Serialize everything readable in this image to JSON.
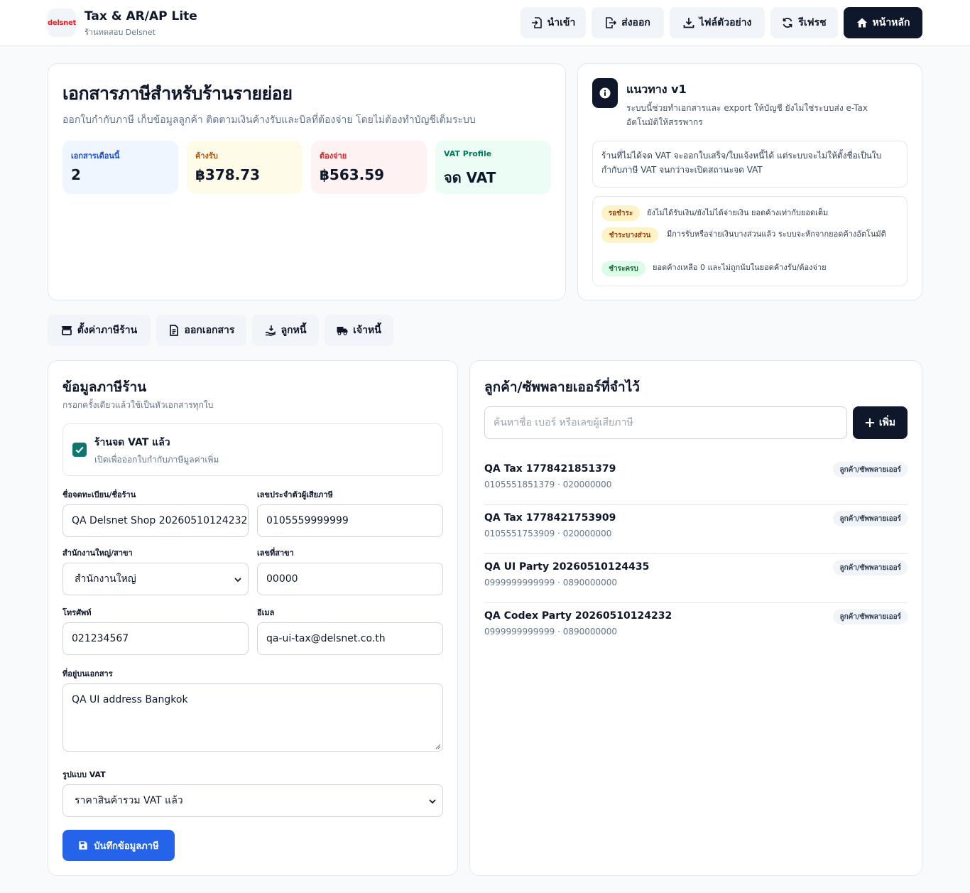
{
  "header": {
    "logo_text": "delsnet",
    "title": "Tax & AR/AP Lite",
    "subtitle": "ร้านทดสอบ Delsnet",
    "buttons": {
      "import": "นำเข้า",
      "export": "ส่งออก",
      "sample": "ไฟล์ตัวอย่าง",
      "refresh": "รีเฟรช",
      "home": "หน้าหลัก"
    }
  },
  "hero": {
    "title": "เอกสารภาษีสำหรับร้านรายย่อย",
    "subtitle": "ออกใบกำกับภาษี เก็บข้อมูลลูกค้า ติดตามเงินค้างรับและบิลที่ต้องจ่าย โดยไม่ต้องทำบัญชีเต็มระบบ",
    "stats": [
      {
        "label": "เอกสารเดือนนี้",
        "value": "2",
        "bg": "#eff6ff",
        "fg": "#1d4ed8"
      },
      {
        "label": "ค้างรับ",
        "value": "฿378.73",
        "bg": "#fefce8",
        "fg": "#b45309"
      },
      {
        "label": "ต้องจ่าย",
        "value": "฿563.59",
        "bg": "#fef2f2",
        "fg": "#dc2626"
      },
      {
        "label": "VAT Profile",
        "value": "จด VAT",
        "bg": "#ecfdf5",
        "fg": "#047857"
      }
    ]
  },
  "guide": {
    "title": "แนวทาง v1",
    "subtitle": "ระบบนี้ช่วยทำเอกสารและ export ให้บัญชี ยังไม่ใช่ระบบส่ง e-Tax อัตโนมัติให้สรรพากร",
    "note": "ร้านที่ไม่ได้จด VAT จะออกใบเสร็จ/ใบแจ้งหนี้ได้ แต่ระบบจะไม่ให้ตั้งชื่อเป็นใบกำกับภาษี VAT จนกว่าจะเปิดสถานะจด VAT",
    "statuses": [
      {
        "badge": "รอชำระ",
        "desc": "ยังไม่ได้รับเงิน/ยังไม่ได้จ่ายเงิน ยอดค้างเท่ากับยอดเต็ม",
        "bg": "#fef3c7",
        "fg": "#92400e"
      },
      {
        "badge": "ชำระบางส่วน",
        "desc": "มีการรับหรือจ่ายเงินบางส่วนแล้ว ระบบจะหักจากยอดค้างอัตโนมัติ",
        "bg": "#fef3c7",
        "fg": "#92400e"
      },
      {
        "badge": "ชำระครบ",
        "desc": "ยอดค้างเหลือ 0 และไม่ถูกนับในยอดค้างรับ/ต้องจ่าย",
        "bg": "#dcfce7",
        "fg": "#166534"
      }
    ]
  },
  "tabs": {
    "settings": "ตั้งค่าภาษีร้าน",
    "issue": "ออกเอกสาร",
    "debtors": "ลูกหนี้",
    "creditors": "เจ้าหนี้"
  },
  "shop_form": {
    "title": "ข้อมูลภาษีร้าน",
    "subtitle": "กรอกครั้งเดียวแล้วใช้เป็นหัวเอกสารทุกใบ",
    "vat_title": "ร้านจด VAT แล้ว",
    "vat_sub": "เปิดเพื่อออกใบกำกับภาษีมูลค่าเพิ่ม",
    "fields": {
      "name_label": "ชื่อจดทะเบียน/ชื่อร้าน",
      "name_value": "QA Delsnet Shop 20260510124232",
      "taxid_label": "เลขประจำตัวผู้เสียภาษี",
      "taxid_value": "0105559999999",
      "branch_type_label": "สำนักงานใหญ่/สาขา",
      "branch_type_value": "สำนักงานใหญ่",
      "branch_no_label": "เลขที่สาขา",
      "branch_no_value": "00000",
      "phone_label": "โทรศัพท์",
      "phone_value": "021234567",
      "email_label": "อีเมล",
      "email_value": "qa-ui-tax@delsnet.co.th",
      "address_label": "ที่อยู่บนเอกสาร",
      "address_value": "QA UI address Bangkok",
      "vat_mode_label": "รูปแบบ VAT",
      "vat_mode_value": "ราคาสินค้ารวม VAT แล้ว"
    },
    "save_label": "บันทึกข้อมูลภาษี"
  },
  "parties": {
    "title": "ลูกค้า/ซัพพลายเออร์ที่จำไว้",
    "search_placeholder": "ค้นหาชื่อ เบอร์ หรือเลขผู้เสียภาษี",
    "add_label": "เพิ่ม",
    "items": [
      {
        "name": "QA Tax 1778421851379",
        "meta": "0105551851379 · 020000000",
        "tag": "ลูกค้า/ซัพพลายเออร์"
      },
      {
        "name": "QA Tax 1778421753909",
        "meta": "0105551753909 · 020000000",
        "tag": "ลูกค้า/ซัพพลายเออร์"
      },
      {
        "name": "QA UI Party 20260510124435",
        "meta": "0999999999999 · 0890000000",
        "tag": "ลูกค้า/ซัพพลายเออร์"
      },
      {
        "name": "QA Codex Party 20260510124232",
        "meta": "0999999999999 · 0890000000",
        "tag": "ลูกค้า/ซัพพลายเออร์"
      }
    ]
  }
}
